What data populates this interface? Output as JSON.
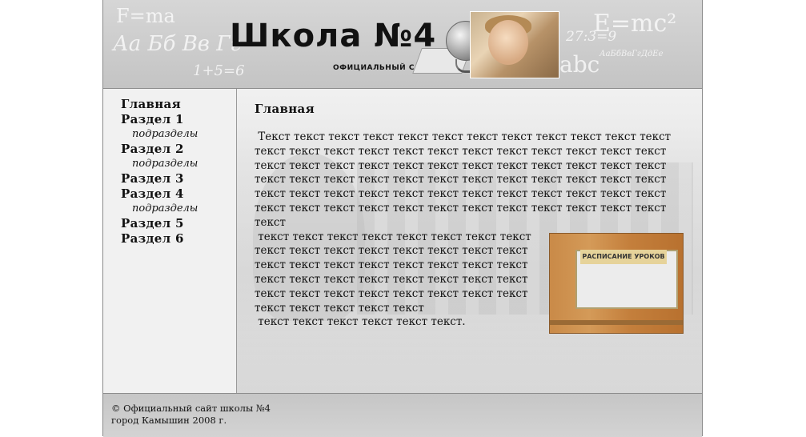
{
  "header": {
    "title": "Школа №4",
    "subtitle": "ОФИЦИАЛЬНЫЙ САЙТ",
    "decorations": [
      "F=ma",
      "Аа Бб Вв Гг",
      "1+5=6",
      "E=mc²",
      "27:3=9",
      "abc",
      "АаБбВвГгДдЕе"
    ]
  },
  "nav": {
    "items": [
      {
        "label": "Главная",
        "type": "main"
      },
      {
        "label": "Раздел 1",
        "type": "main"
      },
      {
        "label": "подразделы",
        "type": "sub"
      },
      {
        "label": "Раздел 2",
        "type": "main"
      },
      {
        "label": "подразделы",
        "type": "sub"
      },
      {
        "label": "Раздел 3",
        "type": "main"
      },
      {
        "label": "Раздел 4",
        "type": "main"
      },
      {
        "label": "подразделы",
        "type": "sub"
      },
      {
        "label": "Раздел 5",
        "type": "main"
      },
      {
        "label": "Раздел 6",
        "type": "main"
      }
    ]
  },
  "main": {
    "heading": "Главная",
    "paragraphs": [
      " Текст текст текст текст текст текст текст текст текст текст текст текст текст текст текст текст текст текст текст текст текст текст текст текст текст текст текст текст текст текст текст текст текст текст текст текст текст текст текст текст текст текст текст текст текст текст текст текст текст текст текст текст текст текст текст текст текст текст текст текст текст текст текст текст текст текст текст текст текст текст текст текст текст",
      " текст текст текст текст текст текст текст текст текст текст текст текст текст текст текст текст текст текст текст текст текст текст текст текст текст текст текст текст текст текст текст текст текст текст текст текст текст текст текст текст текст текст текст текст текст",
      " текст текст текст текст текст текст."
    ],
    "photo_caption": "РАСПИСАНИЕ УРОКОВ"
  },
  "footer": {
    "line1": "© Официальный сайт школы №4",
    "line2": "город Камышин 2008 г."
  },
  "colors": {
    "header_bg": "#cccccc",
    "sidebar_bg": "#f1f1f1",
    "border": "#8c8c8c",
    "text": "#111111"
  }
}
